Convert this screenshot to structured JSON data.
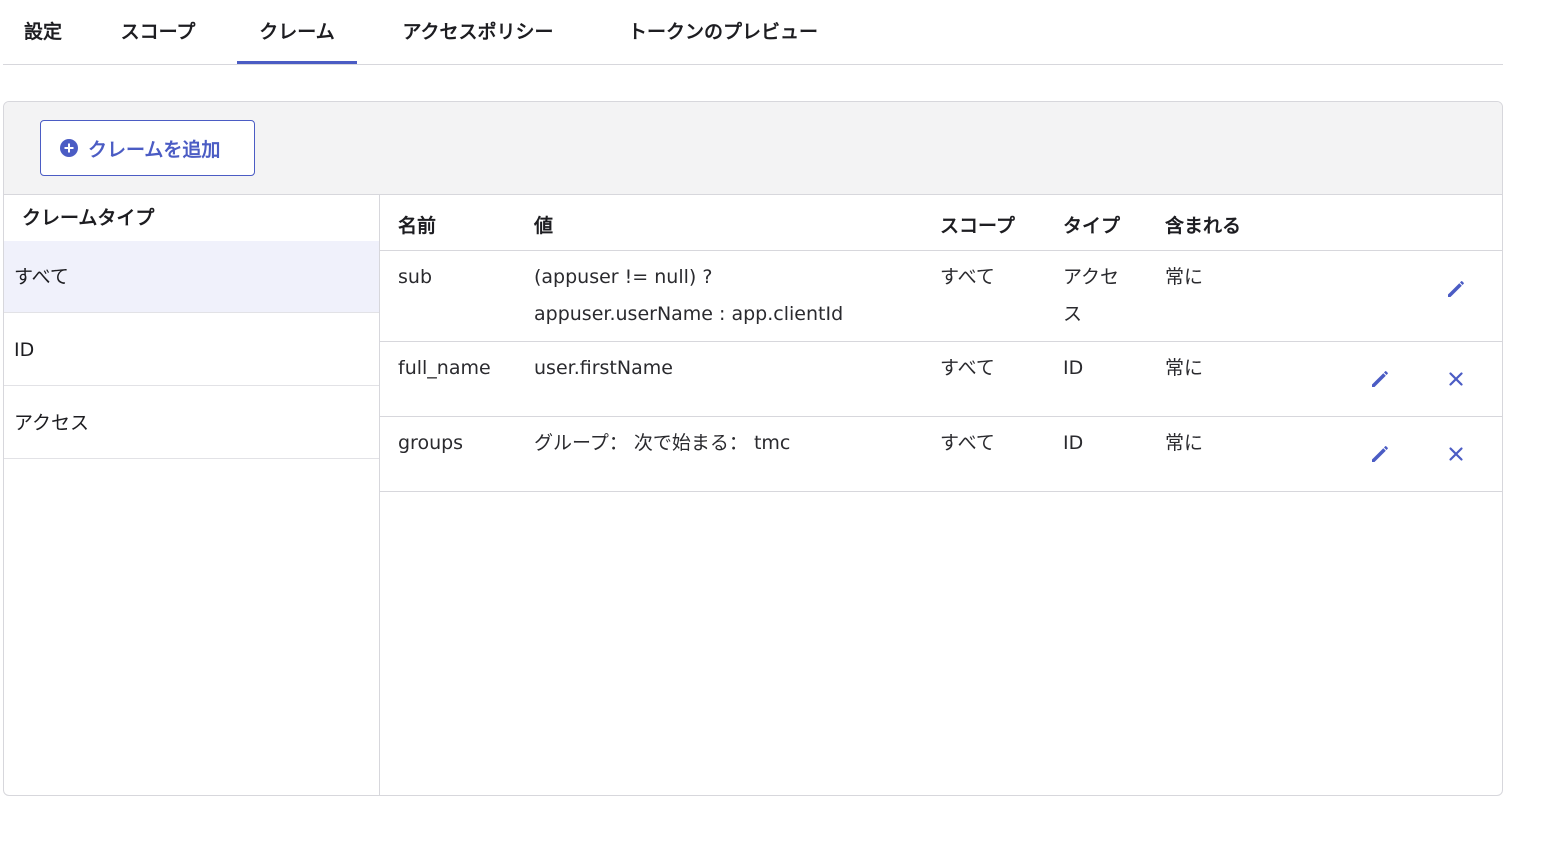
{
  "tabs": [
    {
      "label": "設定"
    },
    {
      "label": "スコープ"
    },
    {
      "label": "クレーム",
      "active": true
    },
    {
      "label": "アクセスポリシー"
    },
    {
      "label": "トークンのプレビュー"
    }
  ],
  "toolbar": {
    "add_claim_label": "クレームを追加"
  },
  "sidebar": {
    "heading": "クレームタイプ",
    "items": [
      {
        "label": "すべて",
        "selected": true
      },
      {
        "label": "ID"
      },
      {
        "label": "アクセス"
      }
    ]
  },
  "table": {
    "headers": {
      "name": "名前",
      "value": "値",
      "scope": "スコープ",
      "type": "タイプ",
      "included": "含まれる"
    },
    "rows": [
      {
        "name": "sub",
        "value": "(appuser != null) ? appuser.userName : app.clientId",
        "scope": "すべて",
        "type": "アクセス",
        "included": "常に",
        "editable": true,
        "deletable": false
      },
      {
        "name": "full_name",
        "value": "user.firstName",
        "scope": "すべて",
        "type": "ID",
        "included": "常に",
        "editable": true,
        "deletable": true
      },
      {
        "name": "groups",
        "value": "グループ： 次で始まる： tmc",
        "scope": "すべて",
        "type": "ID",
        "included": "常に",
        "editable": true,
        "deletable": true
      }
    ]
  },
  "icons": {
    "add": "plus-circle-icon",
    "edit": "pencil-icon",
    "delete": "close-icon"
  },
  "colors": {
    "accent": "#4b5cc4",
    "selected_bg": "#f0f1fb",
    "toolbar_bg": "#f3f3f4"
  }
}
